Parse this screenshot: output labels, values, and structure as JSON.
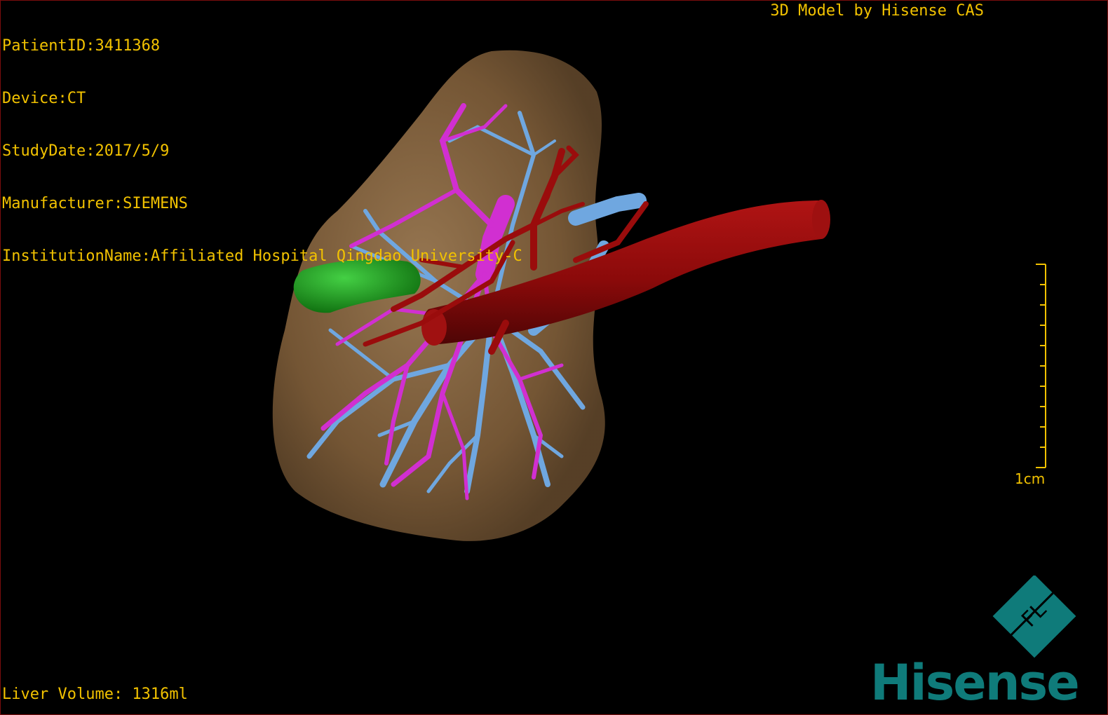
{
  "header": {
    "patient_id": "PatientID:3411368",
    "device": "Device:CT",
    "study_date": "StudyDate:2017/5/9",
    "manufacturer": "Manufacturer:SIEMENS",
    "institution": "InstitutionName:Affiliated Hospital Qingdao University-C",
    "title_right": "3D Model by Hisense CAS"
  },
  "footer": {
    "liver_volume": "Liver Volume: 1316ml"
  },
  "scale_bar": {
    "label": "1cm",
    "ticks": 10
  },
  "logo": {
    "brand": "Hisense",
    "mark": "FL"
  },
  "colors": {
    "text": "#f2c200",
    "liver": "#8c6a44",
    "aorta": "#8b0a0a",
    "hepatic_vein": "#6fa7e0",
    "portal_vein": "#d12fd1",
    "gallbladder": "#1fa11f",
    "logo": "#0f7b7a"
  }
}
